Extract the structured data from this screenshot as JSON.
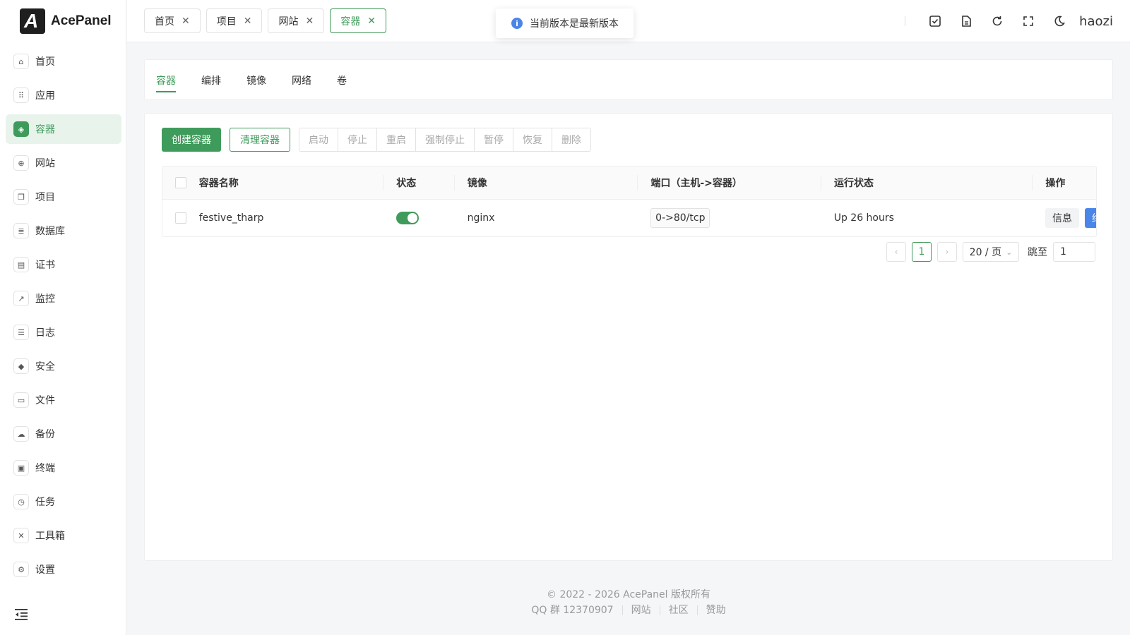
{
  "brand": {
    "name": "AcePanel",
    "logo_letter": "A"
  },
  "sidebar": {
    "items": [
      {
        "label": "首页",
        "icon": "⌂"
      },
      {
        "label": "应用",
        "icon": "⠿"
      },
      {
        "label": "容器",
        "icon": "◈"
      },
      {
        "label": "网站",
        "icon": "⊕"
      },
      {
        "label": "项目",
        "icon": "❐"
      },
      {
        "label": "数据库",
        "icon": "≣"
      },
      {
        "label": "证书",
        "icon": "▤"
      },
      {
        "label": "监控",
        "icon": "↗"
      },
      {
        "label": "日志",
        "icon": "☰"
      },
      {
        "label": "安全",
        "icon": "◆"
      },
      {
        "label": "文件",
        "icon": "▭"
      },
      {
        "label": "备份",
        "icon": "☁"
      },
      {
        "label": "终端",
        "icon": "▣"
      },
      {
        "label": "任务",
        "icon": "◷"
      },
      {
        "label": "工具箱",
        "icon": "✕"
      },
      {
        "label": "设置",
        "icon": "⚙"
      }
    ],
    "active_index": 2
  },
  "header": {
    "tabs": [
      {
        "label": "首页"
      },
      {
        "label": "项目"
      },
      {
        "label": "网站"
      },
      {
        "label": "容器"
      }
    ],
    "active_tab": 3,
    "close_glyph": "✕",
    "toast": {
      "icon": "i",
      "text": "当前版本是最新版本"
    },
    "username": "haozi"
  },
  "subtabs": [
    "容器",
    "编排",
    "镜像",
    "网络",
    "卷"
  ],
  "toolbar": {
    "create": "创建容器",
    "clean": "清理容器",
    "group": [
      "启动",
      "停止",
      "重启",
      "强制停止",
      "暂停",
      "恢复",
      "删除"
    ]
  },
  "table": {
    "headers": {
      "name": "容器名称",
      "status": "状态",
      "image": "镜像",
      "port": "端口（主机->容器）",
      "run": "运行状态",
      "op": "操作"
    },
    "rows": [
      {
        "name": "festive_tharp",
        "status_on": true,
        "image": "nginx",
        "port": "0->80/tcp",
        "run": "Up 26 hours",
        "op_info": "信息",
        "op_term": "终端"
      }
    ]
  },
  "pager": {
    "prev": "‹",
    "next": "›",
    "current": "1",
    "size": "20 / 页",
    "size_caret": "⌄",
    "jump_label": "跳至",
    "jump_value": "1"
  },
  "footer": {
    "copyright": "© 2022 - 2026 AcePanel 版权所有",
    "links": [
      "QQ 群 12370907",
      "网站",
      "社区",
      "赞助"
    ]
  },
  "colors": {
    "accent": "#3f9b5b",
    "info": "#4a86e8"
  }
}
